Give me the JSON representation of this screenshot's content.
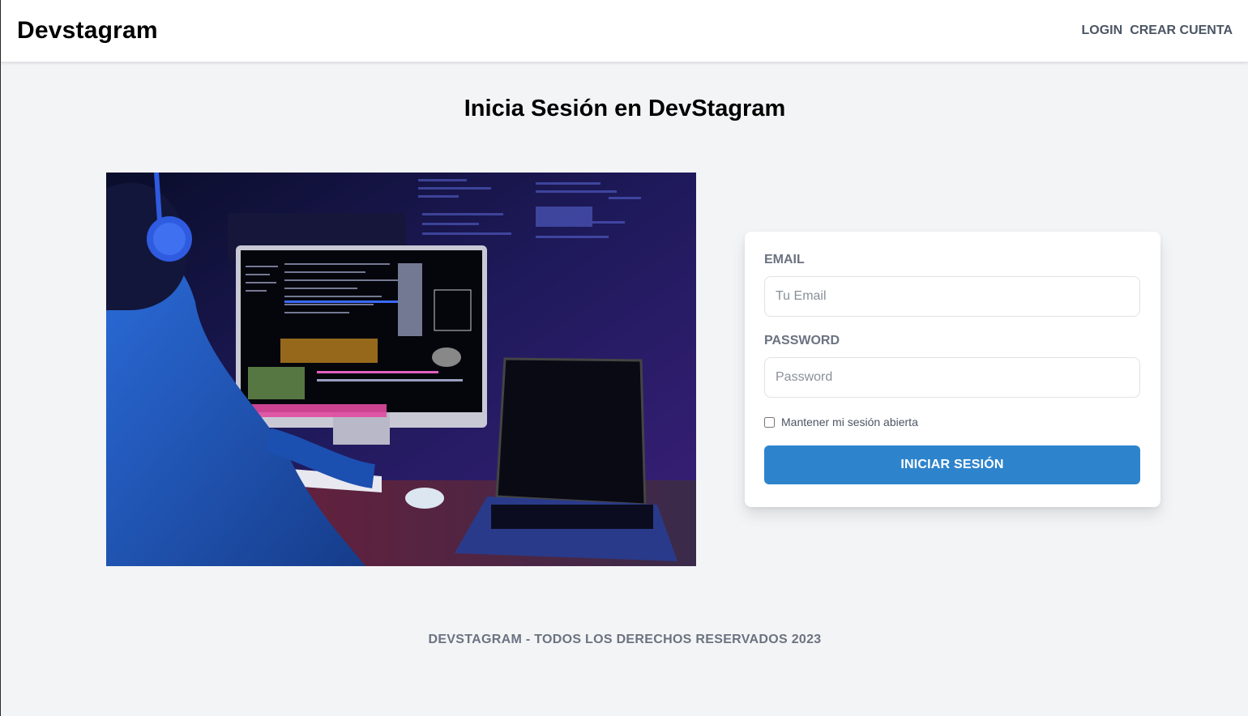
{
  "header": {
    "brand": "Devstagram",
    "nav": {
      "login": "LOGIN",
      "register": "CREAR CUENTA"
    }
  },
  "page": {
    "title": "Inicia Sesión en DevStagram"
  },
  "hero_image": {
    "icon": "developer-at-desk-photo"
  },
  "form": {
    "email_label": "EMAIL",
    "email_placeholder": "Tu Email",
    "email_value": "",
    "password_label": "PASSWORD",
    "password_placeholder": "Password",
    "password_value": "",
    "remember_label": "Mantener mi sesión abierta",
    "remember_checked": false,
    "submit_label": "INICIAR SESIÓN"
  },
  "colors": {
    "accent": "#2e84cc",
    "background": "#f3f4f6",
    "muted_text": "#6b7280"
  },
  "footer": {
    "text": "DEVSTAGRAM - TODOS LOS DERECHOS RESERVADOS 2023"
  }
}
